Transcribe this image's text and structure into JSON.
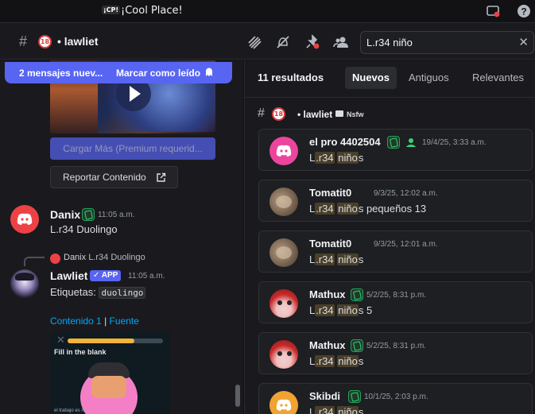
{
  "titlebar": {
    "server_badge": "¡CP!",
    "server_name": "¡Cool Place!"
  },
  "channel": {
    "age_badge": "18",
    "title": "• lawliet"
  },
  "search": {
    "value": "L.r34 niño",
    "clear": "✕"
  },
  "chat": {
    "unread": {
      "count_label": "2 mensajes nuev...",
      "mark_label": "Marcar como leído"
    },
    "load_more": "Cargar Más (Premium requerid...",
    "report_button": "Reportar Contenido",
    "messages": [
      {
        "author": "Danix",
        "time": "11:05 a.m.",
        "text": "L.r34 Duolingo"
      },
      {
        "reply_author": "Danix",
        "reply_text": "L.r34 Duolingo",
        "author": "Lawliet",
        "badge": "✓ APP",
        "time": "11:05 a.m.",
        "text_prefix": "Etiquetas:",
        "code": "duolingo",
        "link1": "Contenido 1",
        "link_sep": "|",
        "link2": "Fuente",
        "embed_title": "Fill in the blank",
        "embed_caption": "el trabajo es mi..."
      }
    ]
  },
  "results": {
    "count": "11 resultados",
    "tabs": [
      "Nuevos",
      "Antiguos",
      "Relevantes"
    ],
    "active_tab": "Nuevos",
    "channel": {
      "age_badge": "18",
      "name": "• lawliet",
      "tag": "Nsfw"
    },
    "items": [
      {
        "author": "el pro 4402504",
        "time": "19/4/25, 3:33 a.m.",
        "pre": "L",
        "hl1": ".r34",
        "mid": " ",
        "hl2": "niño",
        "post": "s"
      },
      {
        "author": "Tomatit0",
        "time": "9/3/25, 12:02 a.m.",
        "pre": "L",
        "hl1": ".r34",
        "mid": " ",
        "hl2": "niño",
        "post": "s pequeños 13"
      },
      {
        "author": "Tomatit0",
        "time": "9/3/25, 12:01 a.m.",
        "pre": "L",
        "hl1": ".r34",
        "mid": " ",
        "hl2": "niño",
        "post": "s"
      },
      {
        "author": "Mathux",
        "time": "5/2/25, 8:31 p.m.",
        "pre": "L",
        "hl1": ".r34",
        "mid": " ",
        "hl2": "niño",
        "post": "s 5"
      },
      {
        "author": "Mathux",
        "time": "5/2/25, 8:31 p.m.",
        "pre": "L",
        "hl1": ".r34",
        "mid": " ",
        "hl2": "niño",
        "post": "s"
      },
      {
        "author": "Skibdi",
        "time": "10/1/25, 2:03 p.m.",
        "pre": "L",
        "hl1": ".r34",
        "mid": " ",
        "hl2": "niño",
        "post": "s"
      }
    ]
  },
  "colors": {
    "accent": "#5865f2",
    "link": "#00a8fc",
    "danger": "#ed4245",
    "highlight": "#4a3f2a"
  }
}
